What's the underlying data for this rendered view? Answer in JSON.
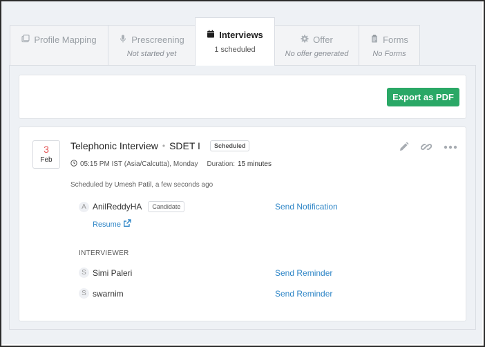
{
  "tabs": [
    {
      "label": "Profile Mapping",
      "sub": "",
      "icon": "profile-icon",
      "active": false
    },
    {
      "label": "Prescreening",
      "sub": "Not started yet",
      "icon": "microphone-icon",
      "active": false
    },
    {
      "label": "Interviews",
      "sub": "1 scheduled",
      "icon": "calendar-icon",
      "active": true
    },
    {
      "label": "Offer",
      "sub": "No offer generated",
      "icon": "gear-icon",
      "active": false
    },
    {
      "label": "Forms",
      "sub": "No Forms",
      "icon": "clipboard-icon",
      "active": false
    }
  ],
  "export_label": "Export as PDF",
  "interview": {
    "day": "3",
    "month": "Feb",
    "type": "Telephonic Interview",
    "role": "SDET I",
    "status": "Scheduled",
    "time": "05:15 PM IST (Asia/Calcutta), Monday",
    "duration_label": "Duration:",
    "duration": "15 minutes",
    "scheduled_by_prefix": "Scheduled by",
    "scheduled_by": "Umesh Patil",
    "scheduled_when": ", a few seconds ago"
  },
  "candidate": {
    "initial": "A",
    "name": "AnilReddyHA",
    "badge": "Candidate",
    "resume": "Resume",
    "action": "Send Notification"
  },
  "interviewer_label": "INTERVIEWER",
  "interviewers": [
    {
      "initial": "S",
      "name": "Simi Paleri",
      "action": "Send Reminder"
    },
    {
      "initial": "S",
      "name": "swarnim",
      "action": "Send Reminder"
    }
  ],
  "colors": {
    "accent": "#2aa866",
    "link": "#2f86c7",
    "date": "#e45757"
  }
}
